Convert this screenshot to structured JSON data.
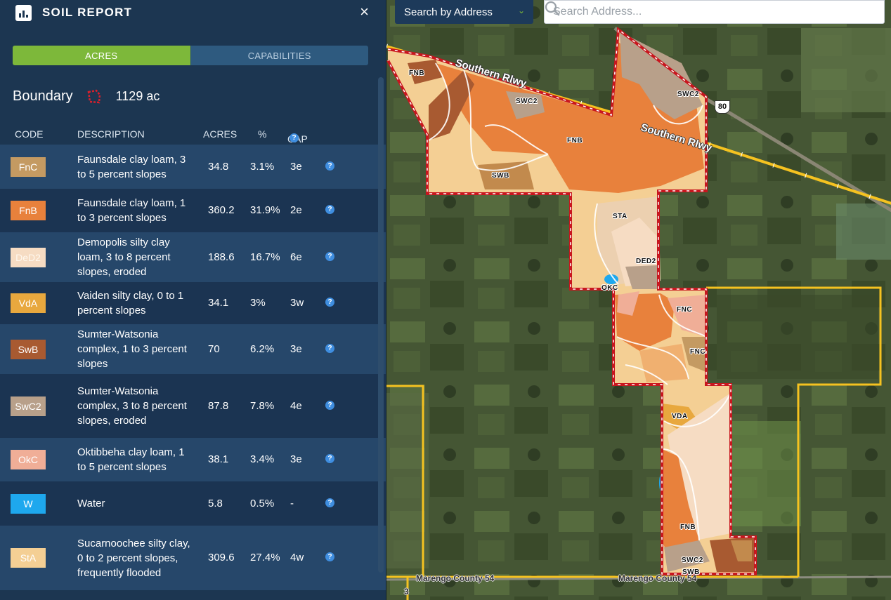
{
  "panel": {
    "title": "SOIL REPORT",
    "close_icon": "×",
    "tabs": [
      "ACRES",
      "CAPABILITIES"
    ],
    "active_tab": "ACRES",
    "boundary_label": "Boundary",
    "boundary_acres": "1129 ac",
    "columns": {
      "code": "CODE",
      "description": "DESCRIPTION",
      "acres": "ACRES",
      "pct": "%",
      "cap": "CAP"
    },
    "help_glyph": "?"
  },
  "soils": [
    {
      "code": "FnC",
      "description": "Faunsdale clay loam, 3 to 5 percent slopes",
      "acres": "34.8",
      "pct": "3.1%",
      "cap": "3e",
      "color": "#c49a62"
    },
    {
      "code": "FnB",
      "description": "Faunsdale clay loam, 1 to 3 percent slopes",
      "acres": "360.2",
      "pct": "31.9%",
      "cap": "2e",
      "color": "#e8813c"
    },
    {
      "code": "DeD2",
      "description": "Demopolis silty clay loam, 3 to 8 percent slopes, eroded",
      "acres": "188.6",
      "pct": "16.7%",
      "cap": "6e",
      "color": "#f6dcc3"
    },
    {
      "code": "VdA",
      "description": "Vaiden silty clay, 0 to 1 percent slopes",
      "acres": "34.1",
      "pct": "3%",
      "cap": "3w",
      "color": "#e8a83e"
    },
    {
      "code": "SwB",
      "description": "Sumter-Watsonia complex, 1 to 3 percent slopes",
      "acres": "70",
      "pct": "6.2%",
      "cap": "3e",
      "color": "#a85a31"
    },
    {
      "code": "SwC2",
      "description": "Sumter-Watsonia complex, 3 to 8 percent slopes, eroded",
      "acres": "87.8",
      "pct": "7.8%",
      "cap": "4e",
      "color": "#b8a08a"
    },
    {
      "code": "OkC",
      "description": "Oktibbeha clay loam, 1 to 5 percent slopes",
      "acres": "38.1",
      "pct": "3.4%",
      "cap": "3e",
      "color": "#f0ae97"
    },
    {
      "code": "W",
      "description": "Water",
      "acres": "5.8",
      "pct": "0.5%",
      "cap": "-",
      "color": "#1ea8ee"
    },
    {
      "code": "StA",
      "description": "Sucarnoochee silty clay, 0 to 2 percent slopes, frequently flooded",
      "acres": "309.6",
      "pct": "27.4%",
      "cap": "4w",
      "color": "#f4cf94"
    }
  ],
  "search": {
    "mode_label": "Search by Address",
    "placeholder": "Search Address..."
  },
  "map": {
    "railway_label": "Southern Rlwy",
    "route_number": "80",
    "county_road_label": "Marengo County 54",
    "edge_label": "3",
    "soil_labels": [
      "FNB",
      "SWC2",
      "SWB",
      "STA",
      "DED2",
      "OKC",
      "FNC",
      "FNC",
      "VDA",
      "FNB",
      "SWC2",
      "SWB",
      "SWC2",
      "FNB"
    ]
  }
}
